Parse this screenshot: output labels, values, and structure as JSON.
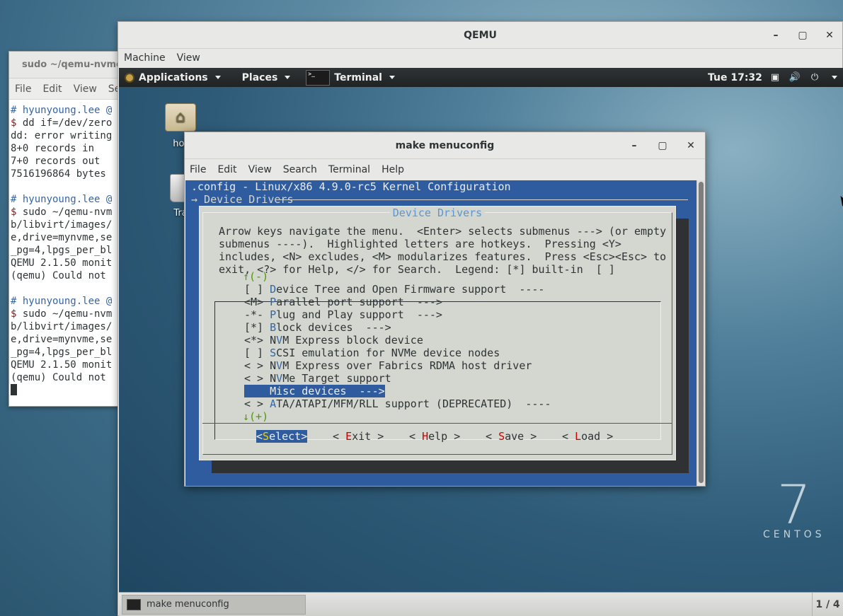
{
  "host_terminal": {
    "title": "sudo ~/qemu-nvme/",
    "menu": [
      "File",
      "Edit",
      "View",
      "Se"
    ],
    "lines": [
      {
        "type": "prompt",
        "text": "hyunyoung.lee @"
      },
      {
        "type": "cmd",
        "text": "dd if=/dev/zero"
      },
      {
        "type": "out",
        "text": "dd: error writing"
      },
      {
        "type": "out",
        "text": "8+0 records in"
      },
      {
        "type": "out",
        "text": "7+0 records out"
      },
      {
        "type": "out",
        "text": "7516196864 bytes"
      },
      {
        "type": "blank",
        "text": ""
      },
      {
        "type": "prompt",
        "text": "hyunyoung.lee @"
      },
      {
        "type": "cmd",
        "text": "sudo ~/qemu-nvm"
      },
      {
        "type": "out",
        "text": "b/libvirt/images/"
      },
      {
        "type": "out",
        "text": "e,drive=mynvme,se"
      },
      {
        "type": "out",
        "text": "_pg=4,lpgs_per_bl"
      },
      {
        "type": "out",
        "text": "QEMU 2.1.50 monit"
      },
      {
        "type": "out",
        "text": "(qemu) Could not"
      },
      {
        "type": "blank",
        "text": ""
      },
      {
        "type": "prompt",
        "text": "hyunyoung.lee @"
      },
      {
        "type": "cmd",
        "text": "sudo ~/qemu-nvm"
      },
      {
        "type": "out",
        "text": "b/libvirt/images/"
      },
      {
        "type": "out",
        "text": "e,drive=mynvme,se"
      },
      {
        "type": "out",
        "text": "_pg=4,lpgs_per_bl"
      },
      {
        "type": "out",
        "text": "QEMU 2.1.50 monit"
      },
      {
        "type": "out",
        "text": "(qemu) Could not"
      }
    ]
  },
  "qemu": {
    "title": "QEMU",
    "menu": [
      "Machine",
      "View"
    ],
    "gnome_bar": {
      "applications": "Applications",
      "places": "Places",
      "terminal": "Terminal",
      "clock": "Tue 17:32"
    },
    "desktop_icons": [
      {
        "label": "hor"
      },
      {
        "label": "Tra"
      }
    ],
    "centos": {
      "numeral": "7",
      "name": "CENTOS"
    },
    "taskbar": {
      "item": "make menuconfig",
      "workspace": "1 / 4"
    }
  },
  "menuconfig_window": {
    "title": "make menuconfig",
    "menu": [
      "File",
      "Edit",
      "View",
      "Search",
      "Terminal",
      "Help"
    ],
    "config_title": ".config - Linux/x86 4.9.0-rc5 Kernel Configuration",
    "breadcrumb": "→ Device Drivers",
    "dialog_title": "Device Drivers",
    "help_lines": [
      "Arrow keys navigate the menu.  <Enter> selects submenus ---> (or empty",
      "submenus ----).  Highlighted letters are hotkeys.  Pressing <Y>",
      "includes, <N> excludes, <M> modularizes features.  Press <Esc><Esc> to",
      "exit, <?> for Help, </> for Search.  Legend: [*] built-in  [ ]"
    ],
    "scroll_up": "↑(-)",
    "scroll_down": "↓(+)",
    "items": [
      {
        "mark": "[ ]",
        "hotkey": "D",
        "rest": "evice Tree and Open Firmware support  ----",
        "selected": false
      },
      {
        "mark": "<M>",
        "hotkey": "P",
        "rest": "arallel port support  --->",
        "selected": false
      },
      {
        "mark": "-*-",
        "hotkey": "P",
        "rest": "lug and Play support  --->",
        "selected": false
      },
      {
        "mark": "[*]",
        "hotkey": "B",
        "rest": "lock devices  --->",
        "selected": false
      },
      {
        "mark": "<*>",
        "hotkey": "V",
        "rest": "M Express block device",
        "prefix": "N",
        "selected": false
      },
      {
        "mark": "[ ]",
        "hotkey": "S",
        "rest": "CSI emulation for NVMe device nodes",
        "selected": false
      },
      {
        "mark": "< >",
        "hotkey": "V",
        "rest": "M Express over Fabrics RDMA host driver",
        "prefix": "N",
        "selected": false
      },
      {
        "mark": "< >",
        "hotkey": "V",
        "rest": "Me Target support",
        "prefix": "N",
        "selected": false
      },
      {
        "mark": "",
        "hotkey": "M",
        "rest": "isc devices  --->",
        "selected": true
      },
      {
        "mark": "< >",
        "hotkey": "A",
        "rest": "TA/ATAPI/MFM/RLL support (DEPRECATED)  ----",
        "selected": false
      }
    ],
    "buttons": [
      {
        "pre": "<",
        "hotkey": "S",
        "post": "elect>",
        "selected": true
      },
      {
        "pre": "< ",
        "hotkey": "E",
        "post": "xit >",
        "selected": false
      },
      {
        "pre": "< ",
        "hotkey": "H",
        "post": "elp >",
        "selected": false
      },
      {
        "pre": "< ",
        "hotkey": "S",
        "post": "ave >",
        "selected": false
      },
      {
        "pre": "< ",
        "hotkey": "L",
        "post": "oad >",
        "selected": false
      }
    ]
  }
}
